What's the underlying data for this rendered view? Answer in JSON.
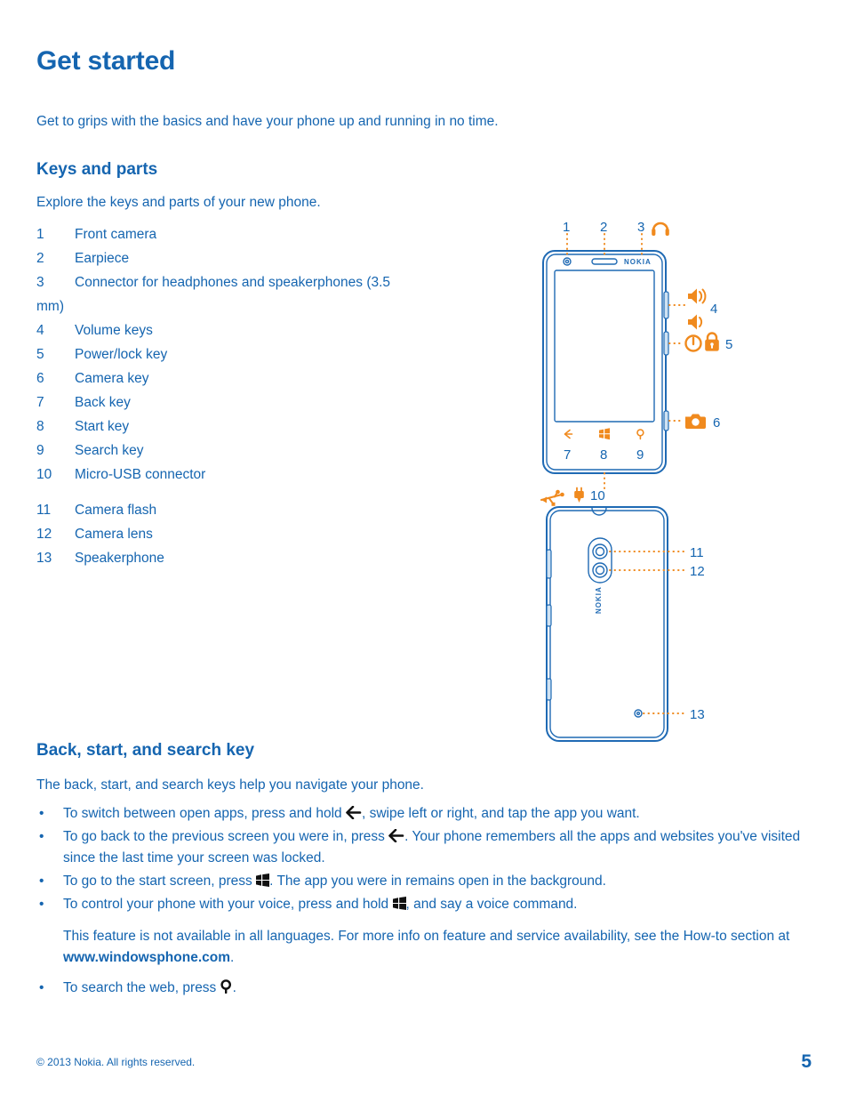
{
  "document": {
    "title": "Get started",
    "intro": "Get to grips with the basics and have your phone up and running in no time."
  },
  "colors": {
    "text_blue": "#1565b0",
    "accent_orange": "#f08a1e",
    "outline_blue": "#1f6ab4",
    "glyph_black": "#111111"
  },
  "keys_and_parts": {
    "heading": "Keys and parts",
    "lead": "Explore the keys and parts of your new phone.",
    "items": [
      {
        "num": "1",
        "label": "Front camera"
      },
      {
        "num": "2",
        "label": "Earpiece"
      },
      {
        "num": "3",
        "label": "Connector for headphones and speakerphones (3.5 mm)"
      },
      {
        "num": "4",
        "label": "Volume keys"
      },
      {
        "num": "5",
        "label": "Power/lock key"
      },
      {
        "num": "6",
        "label": "Camera key"
      },
      {
        "num": "7",
        "label": "Back key"
      },
      {
        "num": "8",
        "label": "Start key"
      },
      {
        "num": "9",
        "label": "Search key"
      },
      {
        "num": "10",
        "label": "Micro-USB connector"
      }
    ],
    "items_back": [
      {
        "num": "11",
        "label": "Camera flash"
      },
      {
        "num": "12",
        "label": "Camera lens"
      },
      {
        "num": "13",
        "label": "Speakerphone"
      }
    ]
  },
  "diagram": {
    "front_brand": "NOKIA",
    "back_brand": "NOKIA",
    "callouts_front_top": [
      "1",
      "2",
      "3"
    ],
    "callouts_front_right": [
      "4",
      "5",
      "6"
    ],
    "callouts_front_bottom": [
      "7",
      "8",
      "9"
    ],
    "callout_usb": "10",
    "callouts_back": [
      "11",
      "12",
      "13"
    ],
    "icons": {
      "headphones": "headphones-icon",
      "volume_up": "volume-up-icon",
      "volume_down": "volume-down-icon",
      "power": "power-icon",
      "lock": "lock-icon",
      "camera": "camera-icon",
      "usb": "usb-icon",
      "charger": "charger-plug-icon",
      "back_key": "back-arrow-icon",
      "start_key": "windows-start-icon",
      "search_key": "search-icon"
    }
  },
  "back_start_search": {
    "heading": "Back, start, and search key",
    "lead": "The back, start, and search keys help you navigate your phone.",
    "bullets": [
      {
        "pre": "To switch between open apps, press and hold ",
        "glyph": "back-arrow-icon",
        "post": ", swipe left or right, and tap the app you want."
      },
      {
        "pre": "To go back to the previous screen you were in, press ",
        "glyph": "back-arrow-icon",
        "post": ". Your phone remembers all the apps and websites you've visited since the last time your screen was locked."
      },
      {
        "pre": "To go to the start screen, press ",
        "glyph": "windows-start-icon",
        "post": ". The app you were in remains open in the background."
      },
      {
        "pre": "To control your phone with your voice, press and hold ",
        "glyph": "windows-start-icon",
        "post": ", and say a voice command."
      }
    ],
    "note_pre": "This feature is not available in all languages. For more info on feature and service availability, see the How-to section at ",
    "note_url": "www.windowsphone.com",
    "note_post": ".",
    "last_bullet": {
      "pre": "To search the web, press ",
      "glyph": "search-icon",
      "post": "."
    },
    "bullet_marker": "•"
  },
  "footer": {
    "copyright": "© 2013 Nokia. All rights reserved.",
    "page_number": "5"
  }
}
